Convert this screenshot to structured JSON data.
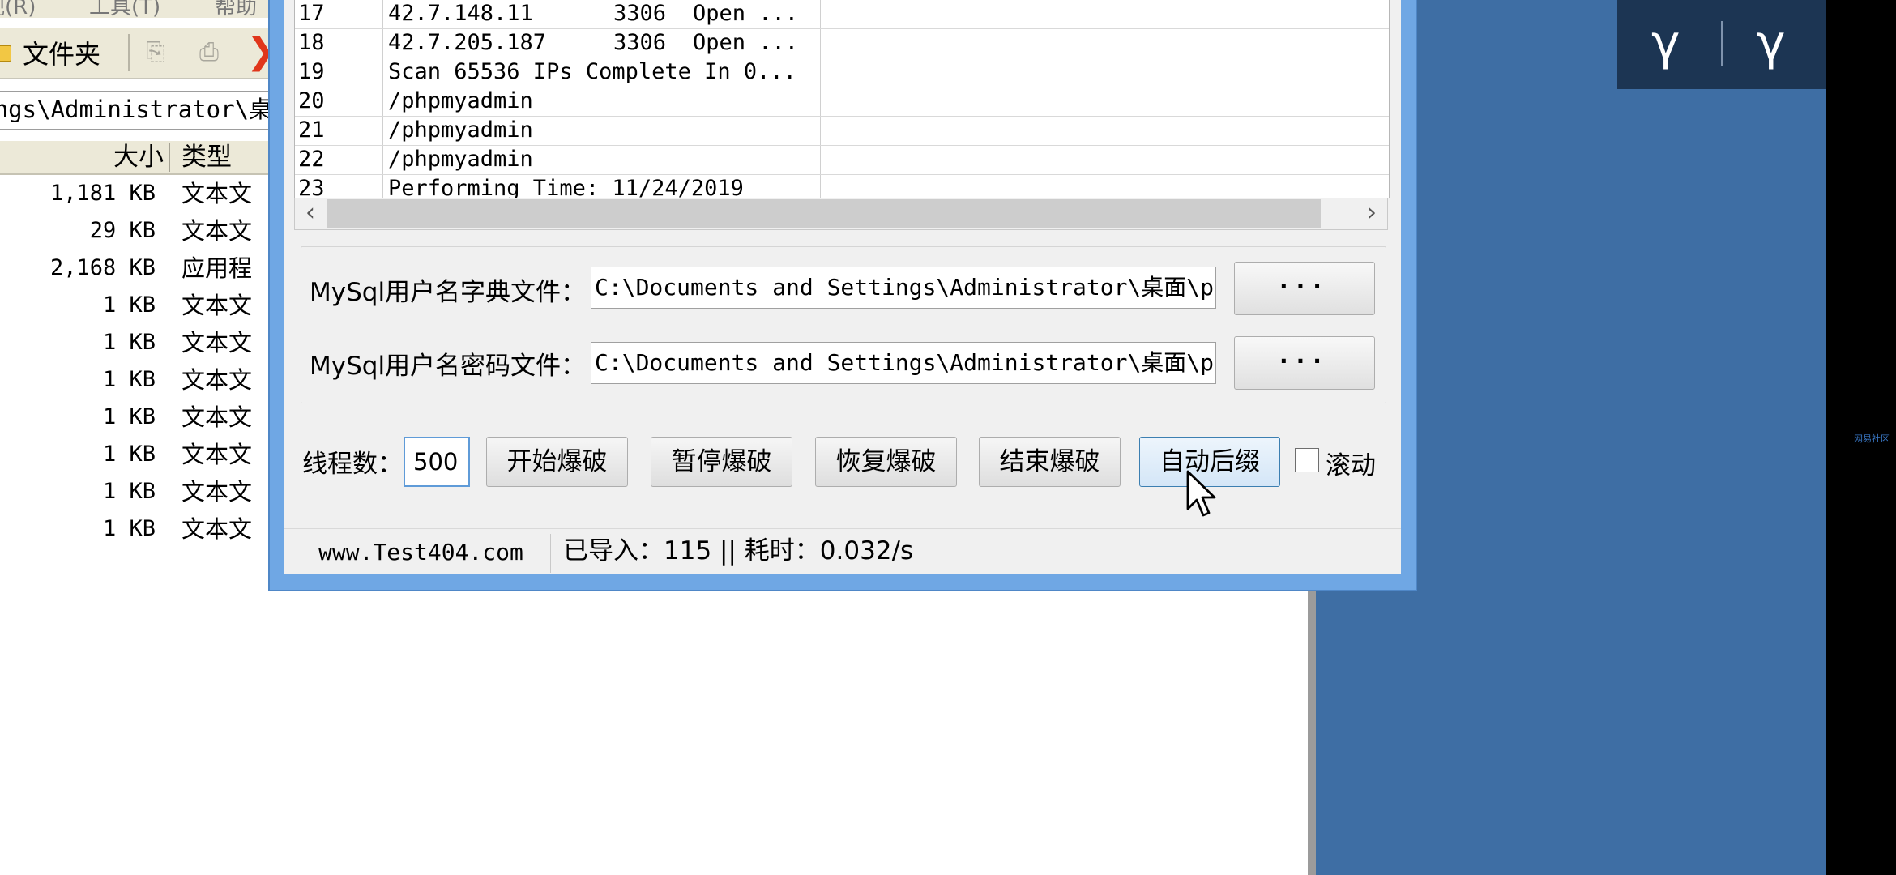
{
  "explorer": {
    "menu_items": [
      "视(R)",
      "工具(T)",
      "帮助"
    ],
    "folders_label": "文件夹",
    "address": "ings\\Administrator\\桌",
    "columns": {
      "size": "大小",
      "type": "类型"
    },
    "files": [
      {
        "size": "1,181 KB",
        "type": "文本文"
      },
      {
        "size": "29 KB",
        "type": "文本文"
      },
      {
        "size": "2,168 KB",
        "type": "应用程"
      },
      {
        "size": "1 KB",
        "type": "文本文"
      },
      {
        "size": "1 KB",
        "type": "文本文"
      },
      {
        "size": "1 KB",
        "type": "文本文"
      },
      {
        "size": "1 KB",
        "type": "文本文"
      },
      {
        "size": "1 KB",
        "type": "文本文"
      },
      {
        "size": "1 KB",
        "type": "文本文"
      },
      {
        "size": "1 KB",
        "type": "文本文"
      }
    ]
  },
  "log": {
    "rows": [
      {
        "num": "17",
        "c1": "42.7.148.11",
        "c2": "3306",
        "c3": "Open ..."
      },
      {
        "num": "18",
        "c1": "42.7.205.187",
        "c2": "3306",
        "c3": "Open ..."
      },
      {
        "num": "19",
        "c1": "Scan 65536 IPs Complete In 0...",
        "c2": "",
        "c3": ""
      },
      {
        "num": "20",
        "c1": "/phpmyadmin",
        "c2": "",
        "c3": ""
      },
      {
        "num": "21",
        "c1": "/phpmyadmin",
        "c2": "",
        "c3": ""
      },
      {
        "num": "22",
        "c1": "/phpmyadmin",
        "c2": "",
        "c3": ""
      },
      {
        "num": "23",
        "c1": "Performing Time: 11/24/2019",
        "c2": "",
        "c3": ""
      }
    ]
  },
  "form": {
    "user_dict_label": "MySql用户名字典文件：",
    "user_dict_value": "C:\\Documents and Settings\\Administrator\\桌面\\pl",
    "pass_dict_label": "MySql用户名密码文件：",
    "pass_dict_value": "C:\\Documents and Settings\\Administrator\\桌面\\pl",
    "browse_label": "···",
    "threads_label": "线程数：",
    "threads_value": "500",
    "start_btn": "开始爆破",
    "pause_btn": "暂停爆破",
    "resume_btn": "恢复爆破",
    "stop_btn": "结束爆破",
    "auto_suffix_btn": "自动后缀",
    "scroll_label": "滚动",
    "scroll_checked": false
  },
  "status": {
    "site": "www.Test404.com",
    "info": "已导入：115 || 耗时：0.032/s"
  },
  "desktop": {
    "logo_left": "γ",
    "logo_right": "γ",
    "watermark": "网易社区"
  },
  "colors": {
    "window_frame": "#6fa7e4",
    "desktop": "#3e6ea4",
    "logo_bg": "#1c3553",
    "accent_button": "#3c7fb1"
  }
}
